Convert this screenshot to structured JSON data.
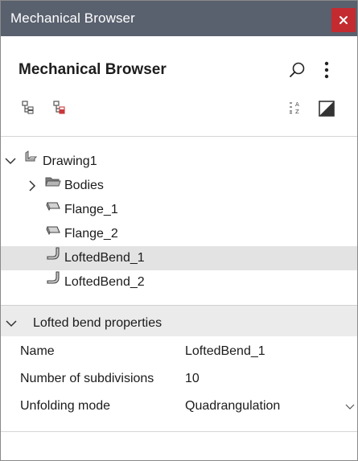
{
  "window": {
    "title": "Mechanical Browser"
  },
  "header": {
    "title": "Mechanical Browser"
  },
  "tree": {
    "root": "Drawing1",
    "items": [
      {
        "label": "Bodies"
      },
      {
        "label": "Flange_1"
      },
      {
        "label": "Flange_2"
      },
      {
        "label": "LoftedBend_1"
      },
      {
        "label": "LoftedBend_2"
      }
    ],
    "selected_item": "LoftedBend_1"
  },
  "properties": {
    "header": "Lofted bend properties",
    "rows": [
      {
        "name": "Name",
        "value": "LoftedBend_1"
      },
      {
        "name": "Number of subdivisions",
        "value": "10"
      },
      {
        "name": "Unfolding mode",
        "value": "Quadrangulation"
      }
    ]
  },
  "colors": {
    "titlebar": "#59606e",
    "close_button": "#c42b31",
    "selection": "#e3e3e3",
    "accent_red": "#c8393c"
  },
  "icons": {
    "close": "close-icon",
    "search": "search-icon",
    "more": "more-vertical-icon",
    "expand_all": "expand-tree-icon",
    "filter_tree": "filter-tree-icon",
    "sort": "sort-az-icon",
    "display_mode": "display-mode-icon"
  }
}
